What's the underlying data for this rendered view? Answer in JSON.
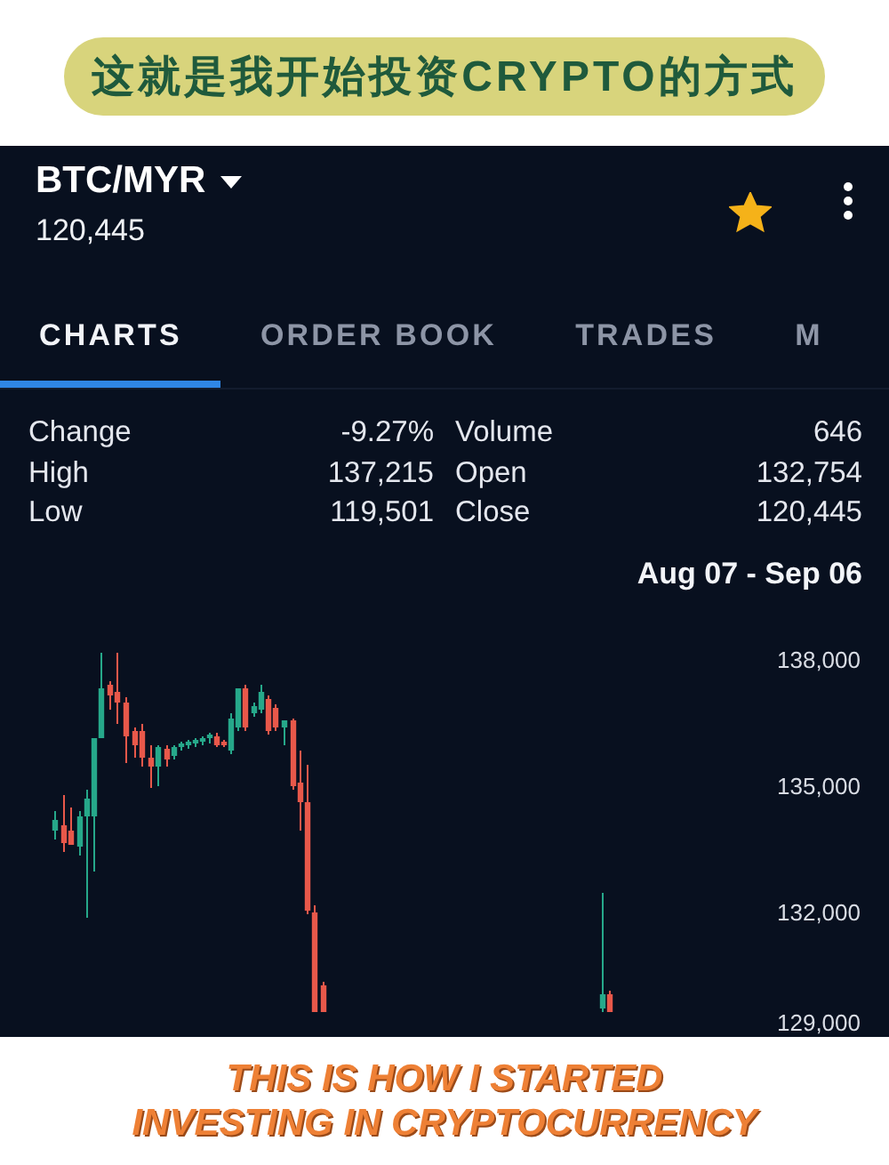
{
  "banner": {
    "text": "这就是我开始投资CRYPTO的方式"
  },
  "header": {
    "pair": "BTC/MYR",
    "price": "120,445",
    "favorite": true
  },
  "tabs": [
    {
      "label": "CHARTS",
      "selected": true
    },
    {
      "label": "ORDER BOOK",
      "selected": false
    },
    {
      "label": "TRADES",
      "selected": false
    },
    {
      "label": "M",
      "selected": false
    }
  ],
  "stats": [
    {
      "label": "Change",
      "value": "-9.27%"
    },
    {
      "label": "Volume",
      "value": "646"
    },
    {
      "label": "High",
      "value": "137,215"
    },
    {
      "label": "Open",
      "value": "132,754"
    },
    {
      "label": "Low",
      "value": "119,501"
    },
    {
      "label": "Close",
      "value": "120,445"
    }
  ],
  "date_range": "Aug 07 - Sep 06",
  "chart": {
    "y_labels": [
      "138,000",
      "135,000",
      "132,000",
      "129,000"
    ]
  },
  "caption": {
    "lines": [
      "THIS IS HOW I STARTED",
      "INVESTING IN CRYPTOCURRENCY"
    ]
  }
}
